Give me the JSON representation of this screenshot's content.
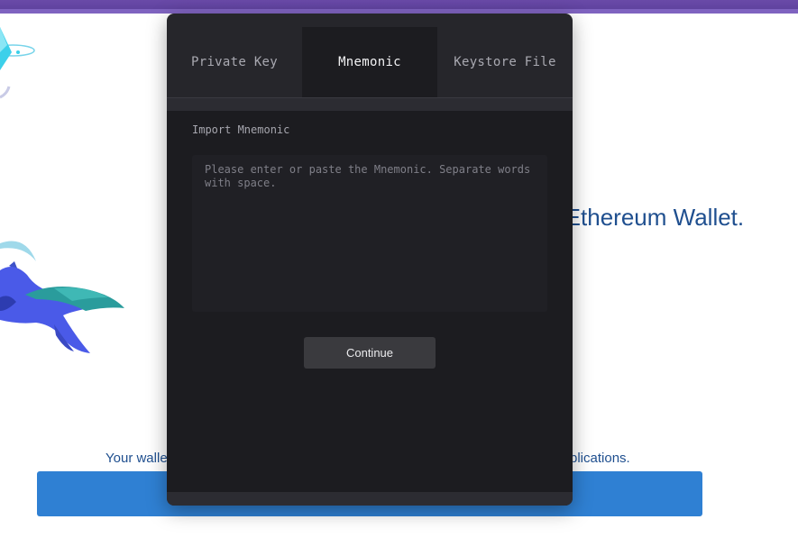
{
  "background": {
    "headline": "o Ethereum Wallet.",
    "subline_left": "Your walle",
    "subline_right": "plications."
  },
  "modal": {
    "tabs": [
      {
        "label": "Private Key"
      },
      {
        "label": "Mnemonic",
        "active": true
      },
      {
        "label": "Keystore File"
      }
    ],
    "panel_label": "Import Mnemonic",
    "mnemonic_placeholder": "Please enter or paste the Mnemonic. Separate words with space.",
    "mnemonic_value": "",
    "continue_label": "Continue"
  },
  "colors": {
    "topbar": "#6a4aa8",
    "modal_bg": "#26262b",
    "panel_bg": "#1c1c20",
    "button_bg": "#3a3a3e",
    "headline_text": "#1f4f8f",
    "blue_bar": "#2f80d3"
  },
  "icons": [
    "ethereum-logo-illustration",
    "fox-mascot-illustration"
  ]
}
